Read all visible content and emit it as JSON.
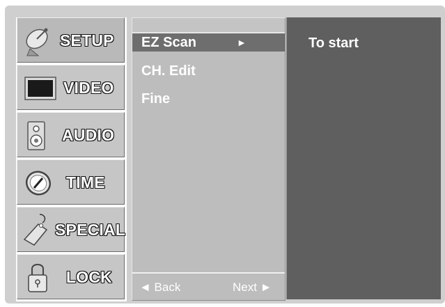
{
  "categories": [
    {
      "label": "SETUP",
      "icon": "satellite-dish-icon"
    },
    {
      "label": "VIDEO",
      "icon": "tv-screen-icon"
    },
    {
      "label": "AUDIO",
      "icon": "speaker-icon"
    },
    {
      "label": "TIME",
      "icon": "clock-icon"
    },
    {
      "label": "SPECIAL",
      "icon": "tag-icon"
    },
    {
      "label": "LOCK",
      "icon": "padlock-icon"
    }
  ],
  "menu": {
    "items": [
      {
        "label": "EZ Scan",
        "arrow": "►"
      },
      {
        "label": "CH. Edit"
      },
      {
        "label": "Fine"
      }
    ],
    "back_label": "◄ Back",
    "next_label": "Next ►"
  },
  "submenu": {
    "hint": "To start"
  }
}
